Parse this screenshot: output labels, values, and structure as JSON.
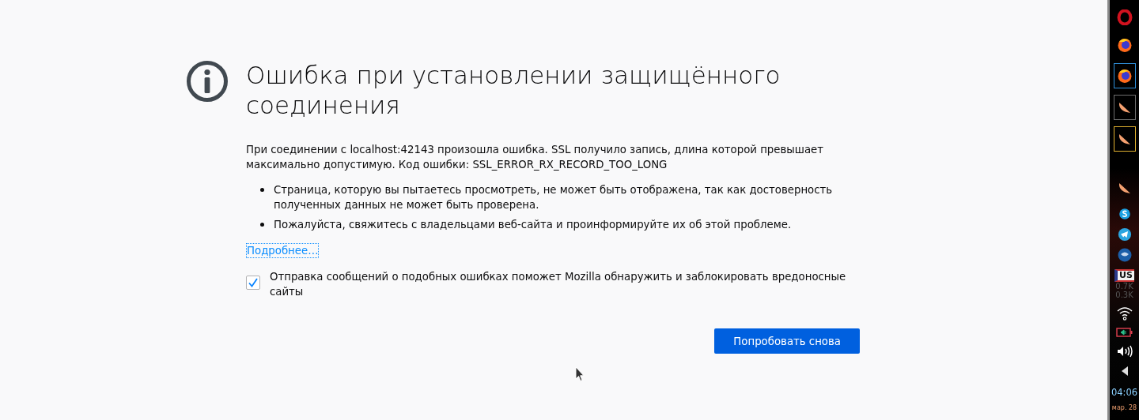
{
  "error_page": {
    "title": "Ошибка при установлении защищённого соединения",
    "message": "При соединении с localhost:42143 произошла ошибка. SSL получило запись, длина которой превышает максимально допустимую. Код ошибки: SSL_ERROR_RX_RECORD_TOO_LONG",
    "bullets": [
      "Страница, которую вы пытаетесь просмотреть, не может быть отображена, так как достоверность полученных данных не может быть проверена.",
      "Пожалуйста, свяжитесь с владельцами веб-сайта и проинформируйте их об этой проблеме."
    ],
    "details_link": "Подробнее…",
    "report_checkbox": {
      "label": "Отправка сообщений о подобных ошибках поможет Mozilla обнаружить и заблокировать вредоносные сайты",
      "checked": true
    },
    "retry_button": "Попробовать снова"
  },
  "taskbar": {
    "apps": [
      {
        "kind": "opera"
      },
      {
        "kind": "firefox"
      },
      {
        "kind": "firefox",
        "window": true,
        "color": "#2f8fd8"
      },
      {
        "kind": "slice",
        "window": true,
        "color": "#6e6e6e"
      },
      {
        "kind": "slice",
        "window": true,
        "color": "#e0b030"
      },
      {
        "kind": "slice"
      },
      {
        "kind": "skype"
      },
      {
        "kind": "telegram"
      },
      {
        "kind": "thunderbird"
      }
    ],
    "layout": "US",
    "net_down": "0.7K",
    "net_up": "0.3K",
    "clock": "04:06",
    "date": "мар. 28"
  }
}
